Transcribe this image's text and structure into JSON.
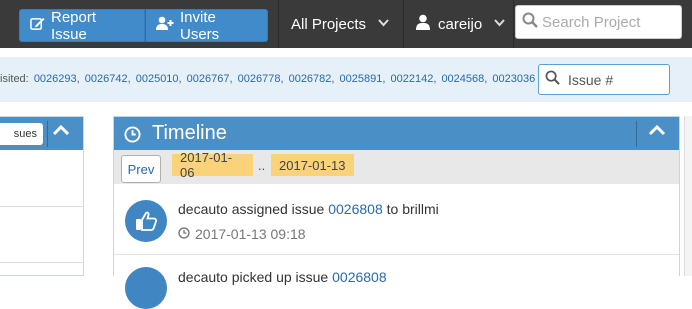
{
  "navbar": {
    "report_issue": "Report Issue",
    "invite_users": "Invite Users",
    "all_projects": "All Projects",
    "user": "careijo",
    "search_placeholder": "Search Project"
  },
  "recent": {
    "label": "isited:",
    "issues": [
      "0026293",
      "0026742",
      "0025010",
      "0026767",
      "0026778",
      "0026782",
      "0025891",
      "0022142",
      "0024568",
      "0023036"
    ],
    "issue_search_placeholder": "Issue #"
  },
  "left_panel": {
    "issues_button": "sues"
  },
  "timeline": {
    "title": "Timeline",
    "prev": "Prev",
    "date_from": "2017-01-06",
    "range_sep": "..",
    "date_to": "2017-01-13",
    "events": [
      {
        "actor": "decauto",
        "action": "assigned issue",
        "issue": "0026808",
        "suffix": "to brillmi",
        "time": "2017-01-13 09:18"
      },
      {
        "actor": "decauto",
        "action": "picked up issue",
        "issue": "0026808",
        "suffix": "",
        "time": ""
      }
    ]
  },
  "colors": {
    "navbar": "#3a3a3a",
    "accent": "#4a8fc6",
    "date_chip": "#fad27a"
  }
}
